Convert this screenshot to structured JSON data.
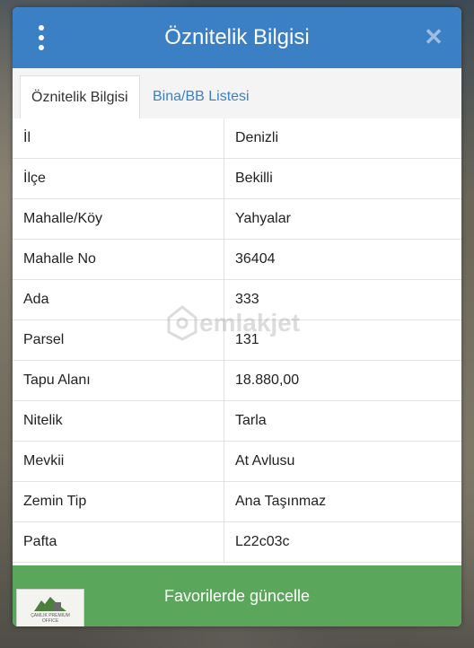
{
  "header": {
    "title": "Öznitelik Bilgisi",
    "menu_icon": "kebab-vertical-icon",
    "close_icon": "close-icon"
  },
  "tabs": [
    {
      "label": "Öznitelik Bilgisi",
      "active": true
    },
    {
      "label": "Bina/BB Listesi",
      "active": false
    }
  ],
  "rows": [
    {
      "key": "İl",
      "value": "Denizli"
    },
    {
      "key": "İlçe",
      "value": "Bekilli"
    },
    {
      "key": "Mahalle/Köy",
      "value": "Yahyalar"
    },
    {
      "key": "Mahalle No",
      "value": "36404"
    },
    {
      "key": "Ada",
      "value": "333"
    },
    {
      "key": "Parsel",
      "value": "131"
    },
    {
      "key": "Tapu Alanı",
      "value": "18.880,00"
    },
    {
      "key": "Nitelik",
      "value": "Tarla"
    },
    {
      "key": "Mevkii",
      "value": "At Avlusu"
    },
    {
      "key": "Zemin Tip",
      "value": "Ana Taşınmaz"
    },
    {
      "key": "Pafta",
      "value": "L22c03c"
    }
  ],
  "watermark": {
    "text": "emlakjet"
  },
  "footer": {
    "button_label": "Favorilerde güncelle"
  },
  "logo": {
    "line1": "ÇAMLIK PREMIUM",
    "line2": "OFFICE"
  },
  "colors": {
    "header": "#3b7fc4",
    "footer": "#5aa65a",
    "tab_link": "#3b7fc4"
  }
}
